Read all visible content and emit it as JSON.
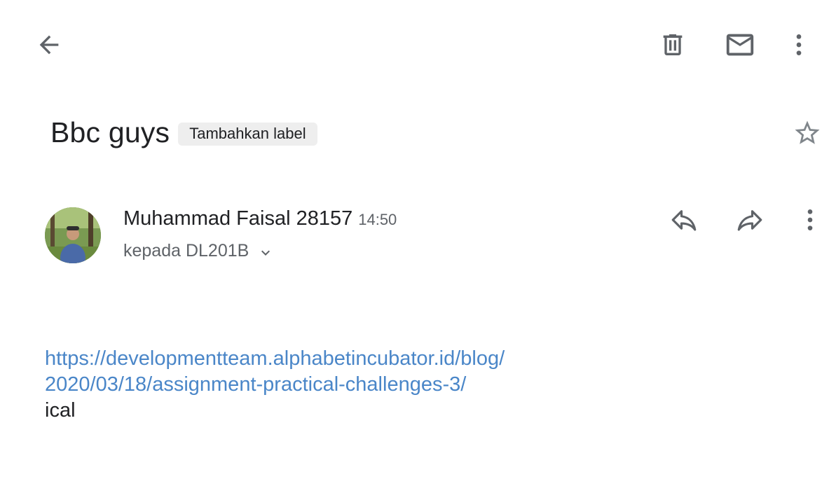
{
  "toolbar": {
    "back_icon": "arrow-back-icon",
    "delete_icon": "trash-icon",
    "mark_unread_icon": "mail-icon",
    "overflow_icon": "more-vert-icon"
  },
  "subject": {
    "title": "Bbc guys",
    "label_chip": "Tambahkan label",
    "star_icon": "star-outline-icon"
  },
  "message": {
    "sender": "Muhammad Faisal 28157",
    "time": "14:50",
    "recipients": "kepada DL201B",
    "avatar_icon": "avatar-photo",
    "actions": {
      "reply_icon": "reply-icon",
      "forward_icon": "forward-icon",
      "more_icon": "more-vert-icon"
    },
    "body": {
      "link_line1": "https://developmentteam.alphabetincubator.id/blog/",
      "link_line2": "2020/03/18/assignment-practical-challenges-3/",
      "text": "ical"
    }
  },
  "colors": {
    "link": "#4a86c8",
    "icon": "#5f6368",
    "chip_bg": "#eeeeee"
  }
}
